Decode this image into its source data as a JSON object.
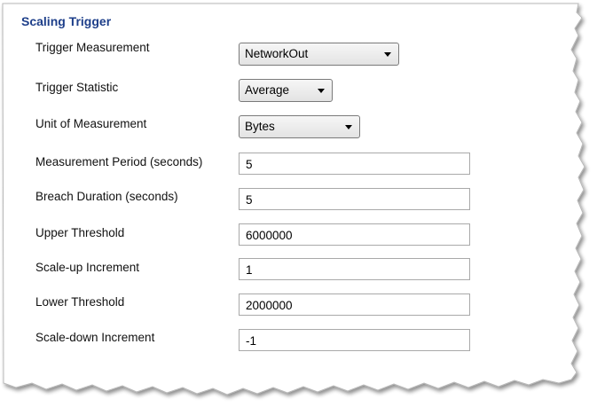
{
  "section": {
    "title": "Scaling Trigger"
  },
  "fields": {
    "trigger_measurement": {
      "label": "Trigger Measurement",
      "value": "NetworkOut"
    },
    "trigger_statistic": {
      "label": "Trigger Statistic",
      "value": "Average"
    },
    "unit_of_measurement": {
      "label": "Unit of Measurement",
      "value": "Bytes"
    },
    "measurement_period": {
      "label": "Measurement Period (seconds)",
      "value": "5"
    },
    "breach_duration": {
      "label": "Breach Duration (seconds)",
      "value": "5"
    },
    "upper_threshold": {
      "label": "Upper Threshold",
      "value": "6000000"
    },
    "scale_up_increment": {
      "label": "Scale-up Increment",
      "value": "1"
    },
    "lower_threshold": {
      "label": "Lower Threshold",
      "value": "2000000"
    },
    "scale_down_increment": {
      "label": "Scale-down Increment",
      "value": "-1"
    }
  },
  "icons": {
    "dropdown_arrow": "chevron-down-icon"
  }
}
